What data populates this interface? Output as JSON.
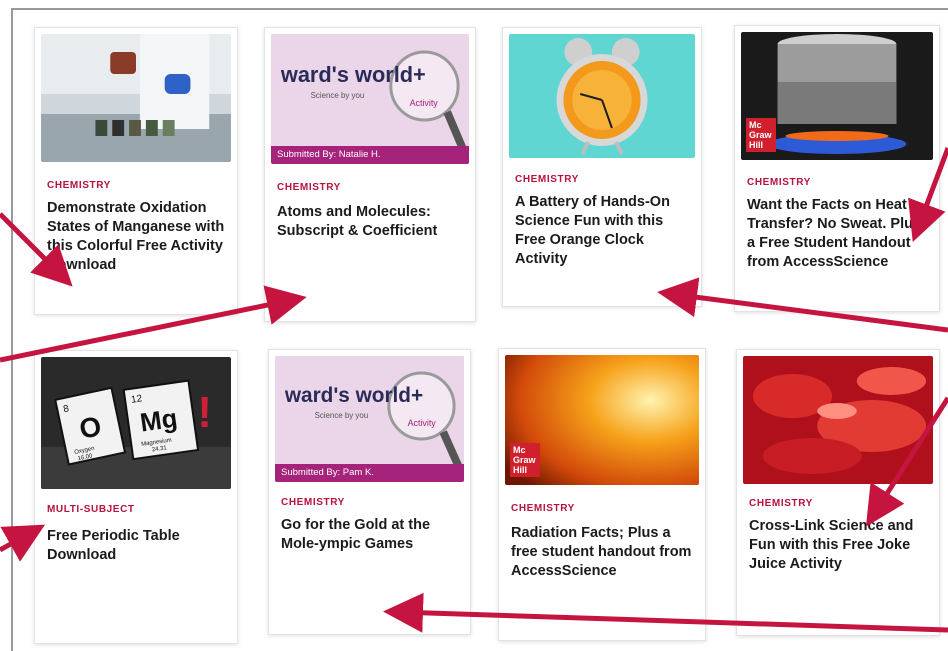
{
  "cards": [
    {
      "category": "CHEMISTRY",
      "title": "Demonstrate Oxidation States of Manganese with this Colorful Free Activity Download"
    },
    {
      "category": "CHEMISTRY",
      "title": "Atoms and Molecules: Subscript & Coefficient",
      "badge": "Submitted By: Natalie H.",
      "logo_main": "ward's world+",
      "logo_sub": "Science by you",
      "logo_tag": "Activity"
    },
    {
      "category": "CHEMISTRY",
      "title": "A Battery of Hands-On Science Fun with this Free Orange Clock Activity"
    },
    {
      "category": "CHEMISTRY",
      "title": "Want the Facts on Heat Transfer? No Sweat. Plus a Free Student Handout from AccessScience",
      "publisher": "Mc Graw Hill"
    },
    {
      "category": "MULTI-SUBJECT",
      "title": "Free Periodic Table Download",
      "tile1_symbol": "O",
      "tile1_number": "8",
      "tile1_name": "Oxygen",
      "tile1_mass": "16.00",
      "tile2_symbol": "Mg",
      "tile2_number": "12",
      "tile2_name": "Magnesium",
      "tile2_mass": "24.31",
      "mark": "!"
    },
    {
      "category": "CHEMISTRY",
      "title": "Go for the Gold at the Mole-ympic Games",
      "badge": "Submitted By: Pam K.",
      "logo_main": "ward's world+",
      "logo_sub": "Science by you",
      "logo_tag": "Activity"
    },
    {
      "category": "CHEMISTRY",
      "title": "Radiation Facts; Plus a free student handout from AccessScience",
      "publisher": "Mc Graw Hill"
    },
    {
      "category": "CHEMISTRY",
      "title": "Cross-Link Science and Fun with this Free Joke Juice Activity"
    }
  ],
  "colors": {
    "accent": "#b8123e",
    "arrow": "#c4143f"
  }
}
